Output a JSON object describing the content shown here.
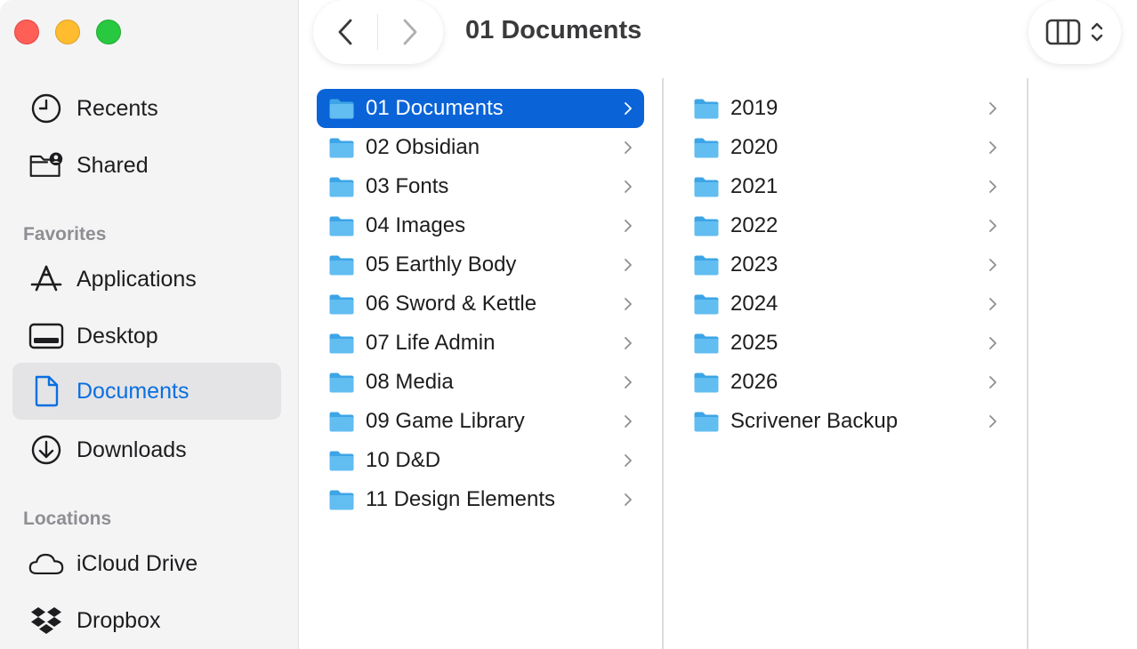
{
  "window": {
    "title": "01 Documents"
  },
  "sidebar": {
    "items_top": [
      {
        "label": "Recents",
        "icon": "clock-icon"
      },
      {
        "label": "Shared",
        "icon": "shared-folder-icon"
      }
    ],
    "favorites_header": "Favorites",
    "favorites": [
      {
        "label": "Applications",
        "icon": "applications-icon"
      },
      {
        "label": "Desktop",
        "icon": "desktop-icon"
      },
      {
        "label": "Documents",
        "icon": "document-icon",
        "selected": true
      },
      {
        "label": "Downloads",
        "icon": "download-icon"
      }
    ],
    "locations_header": "Locations",
    "locations": [
      {
        "label": "iCloud Drive",
        "icon": "cloud-icon"
      },
      {
        "label": "Dropbox",
        "icon": "dropbox-icon"
      }
    ]
  },
  "column1": {
    "items": [
      "01 Documents",
      "02 Obsidian",
      "03 Fonts",
      "04 Images",
      "05 Earthly Body",
      "06 Sword & Kettle",
      "07 Life Admin",
      "08 Media",
      "09 Game Library",
      "10 D&D",
      "11 Design Elements"
    ],
    "selected_index": 0
  },
  "column2": {
    "items": [
      "2019",
      "2020",
      "2021",
      "2022",
      "2023",
      "2024",
      "2025",
      "2026",
      "Scrivener Backup"
    ]
  },
  "colors": {
    "accent": "#0a64d8",
    "sidebar_accent": "#0a6fe0",
    "folder": "#5ab8ee"
  }
}
